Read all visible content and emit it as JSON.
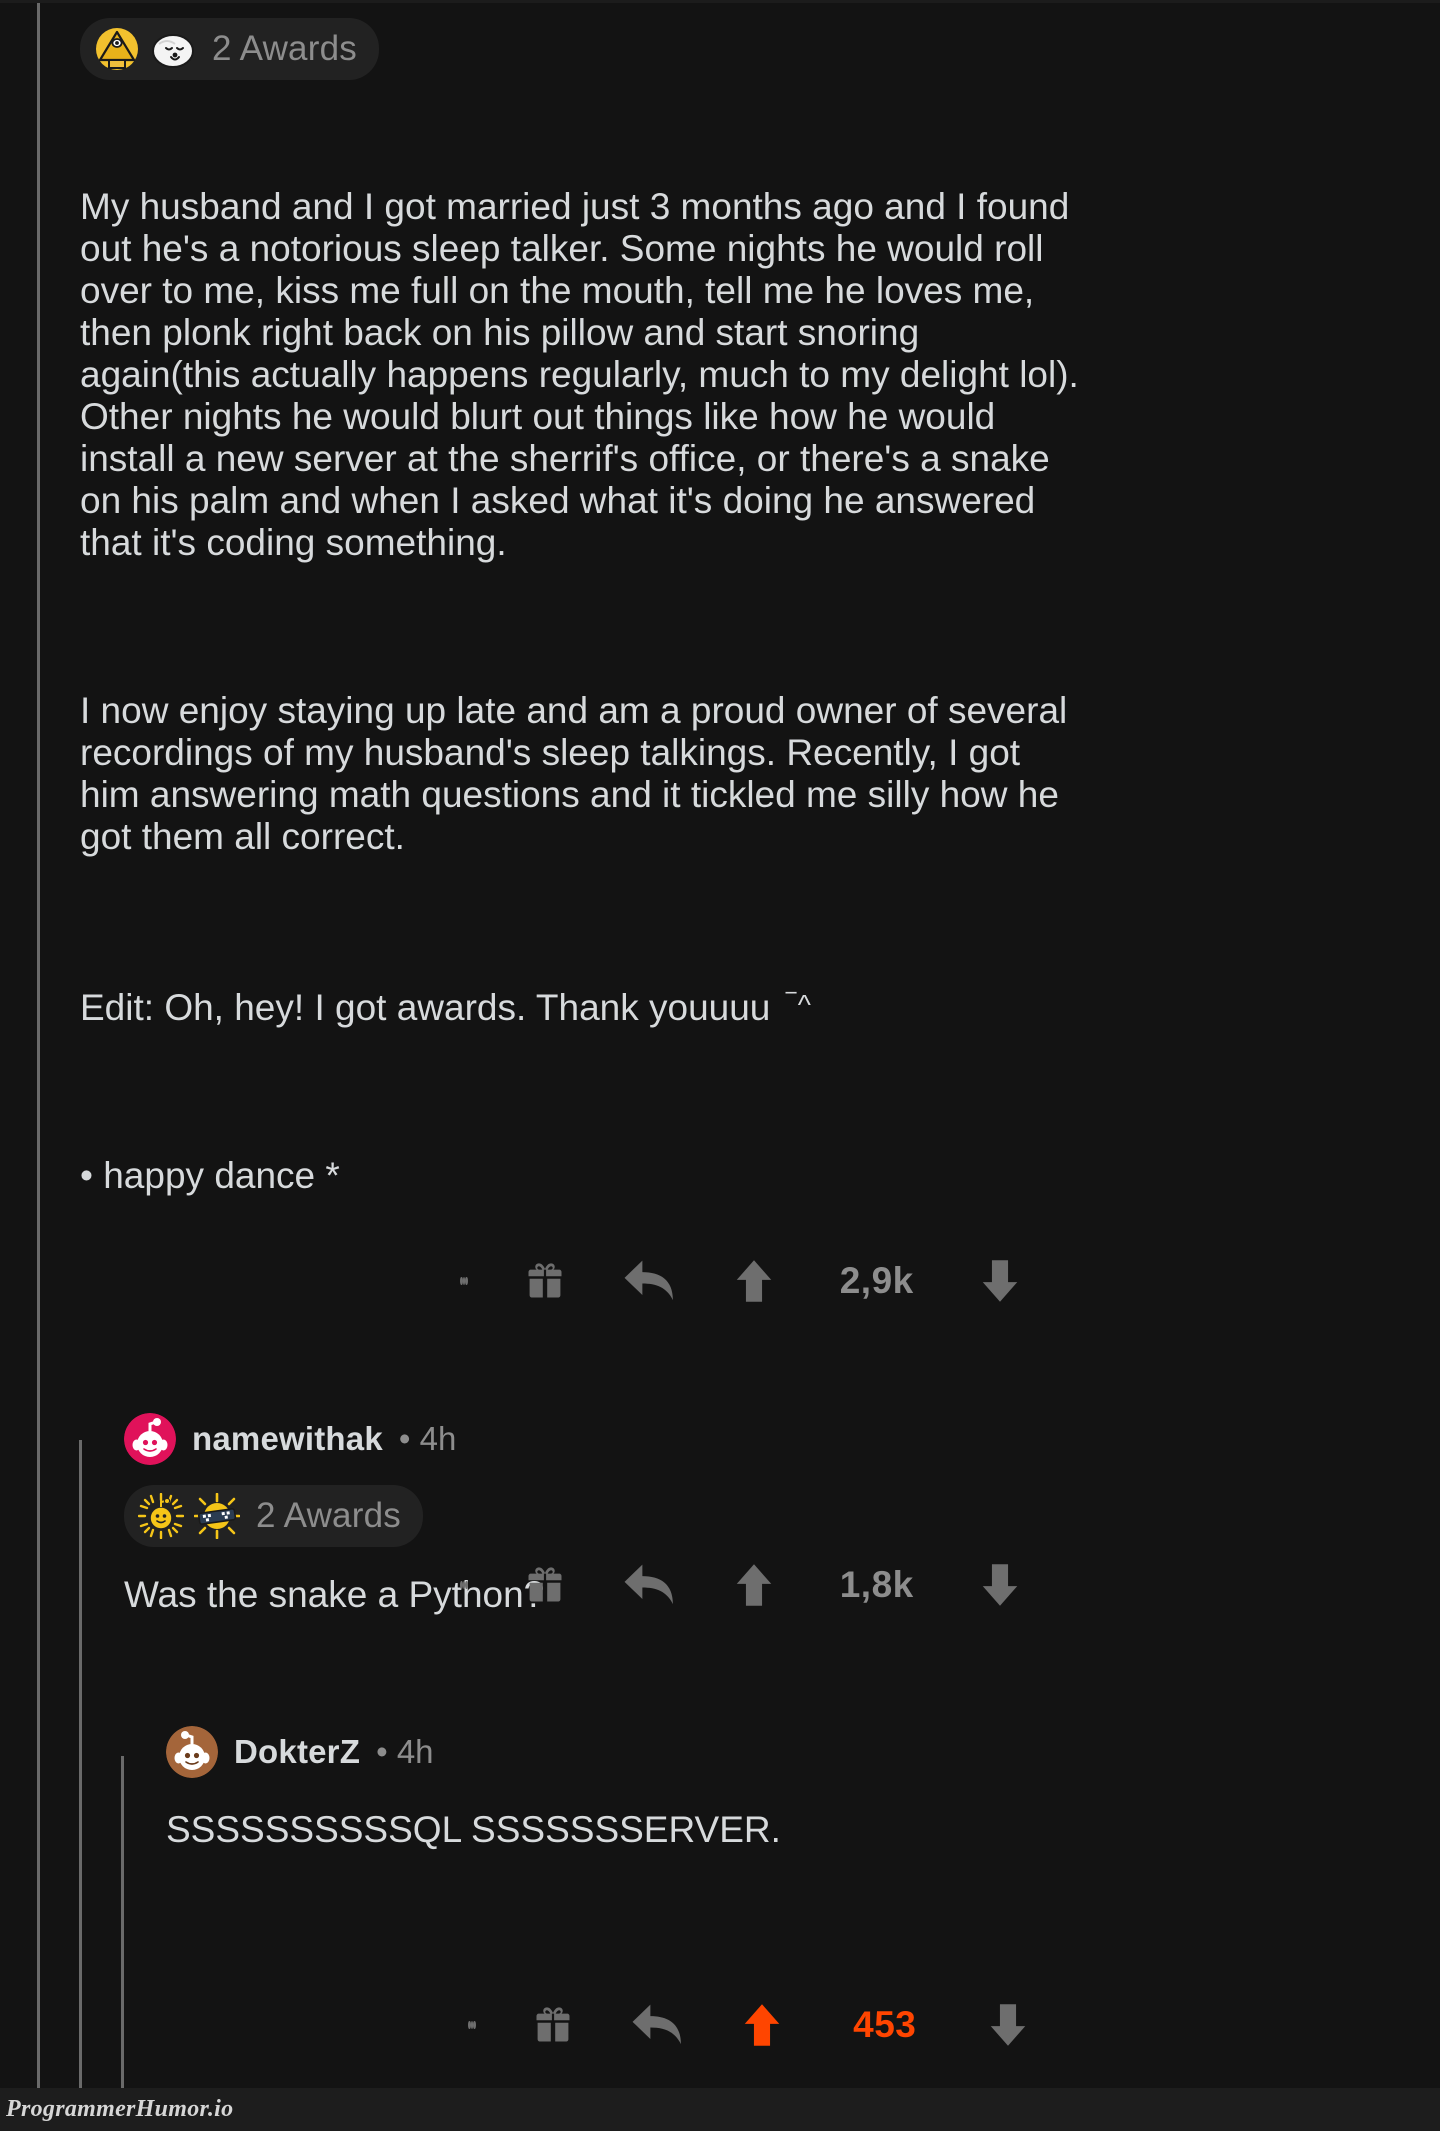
{
  "theme": {
    "background": "#131313",
    "text": "#d7dadc",
    "muted": "#8d8d8d",
    "thread_line": "#6a6a6a",
    "upvote_active": "#ff4500",
    "pill_background": "#222222"
  },
  "post": {
    "awards": {
      "label": "2 Awards",
      "badges": [
        "illuminati-award-icon",
        "wholesome-seal-award-icon"
      ]
    },
    "paragraphs": [
      "My husband and I got married just 3 months ago and I found out he's a notorious sleep talker. Some nights he would roll over to me, kiss me full on the mouth, tell me he loves me, then plonk right back on his pillow and start snoring again(this actually happens regularly, much to my delight lol). Other nights he would blurt out things like how he would install a new server at the sherrif's office, or there's a snake on his palm and when I asked what it's doing he answered that it's coding something.",
      "I now enjoy staying up late and am a proud owner of several recordings of my husband's sleep talkings. Recently, I got him answering math questions and it tickled me silly how he got them all correct.",
      "Edit: Oh, hey! I got awards. Thank youuuu",
      "• happy dance *"
    ],
    "edit_emoticon": "‾^",
    "actions": {
      "more_label": "more-options",
      "award_label": "give-award",
      "reply_label": "reply",
      "upvote_label": "upvote",
      "downvote_label": "downvote",
      "score": "2,9k",
      "score_active": false
    }
  },
  "comments": [
    {
      "author": "namewithak",
      "meta": "• 4h",
      "avatar_color": "#e0125a",
      "awards": {
        "label": "2 Awards",
        "badges": [
          "gold-snoo-award-icon",
          "sunglasses-sun-award-icon"
        ]
      },
      "body": "Was the snake a Python?",
      "actions": {
        "more_label": "more-options",
        "award_label": "give-award",
        "reply_label": "reply",
        "upvote_label": "upvote",
        "downvote_label": "downvote",
        "score": "1,8k",
        "score_active": false
      }
    },
    {
      "author": "DokterZ",
      "meta": "• 4h",
      "avatar_color": "#a4653a",
      "awards": null,
      "body": "SSSSSSSSSSQL SSSSSSSERVER.",
      "actions": {
        "more_label": "more-options",
        "award_label": "give-award",
        "reply_label": "reply",
        "upvote_label": "upvote",
        "downvote_label": "downvote",
        "score": "453",
        "score_active": true
      }
    }
  ],
  "footer": {
    "watermark": "ProgrammerHumor.io"
  }
}
